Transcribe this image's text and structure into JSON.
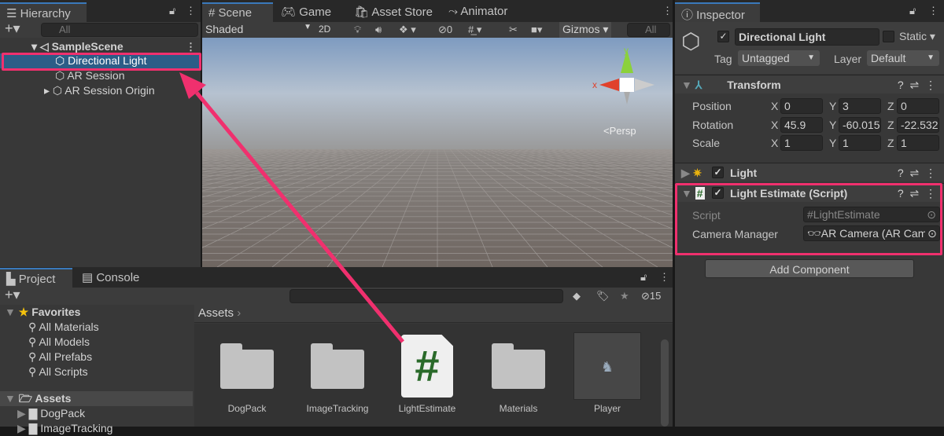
{
  "hierarchy": {
    "tab": "Hierarchy",
    "search_placeholder": "All",
    "scene": "SampleScene",
    "items": [
      "Directional Light",
      "AR Session",
      "AR Session Origin"
    ]
  },
  "scene": {
    "tabs": [
      "Scene",
      "Game",
      "Asset Store",
      "Animator"
    ],
    "shading": "Shaded",
    "mode_2d": "2D",
    "hidden_count": "0",
    "gizmos": "Gizmos",
    "search_placeholder": "All",
    "persp": "<Persp",
    "axis_y": "y",
    "axis_x": "x"
  },
  "inspector": {
    "tab": "Inspector",
    "object_name": "Directional Light",
    "static": "Static",
    "tag_label": "Tag",
    "tag": "Untagged",
    "layer_label": "Layer",
    "layer": "Default",
    "transform": {
      "title": "Transform",
      "rows": [
        {
          "label": "Position",
          "x": "0",
          "y": "3",
          "z": "0"
        },
        {
          "label": "Rotation",
          "x": "45.9",
          "y": "-60.015",
          "z": "-22.532"
        },
        {
          "label": "Scale",
          "x": "1",
          "y": "1",
          "z": "1"
        }
      ]
    },
    "light": {
      "title": "Light"
    },
    "light_estimate": {
      "title": "Light Estimate (Script)",
      "script_label": "Script",
      "script_value": "LightEstimate",
      "camera_label": "Camera Manager",
      "camera_value": "AR Camera (AR Camera Manager)"
    },
    "add_component": "Add Component"
  },
  "project": {
    "tabs": [
      "Project",
      "Console"
    ],
    "hidden_count": "15",
    "favorites": "Favorites",
    "fav_items": [
      "All Materials",
      "All Models",
      "All Prefabs",
      "All Scripts"
    ],
    "assets_root": "Assets",
    "tree": [
      "DogPack",
      "ImageTracking"
    ],
    "breadcrumb": "Assets",
    "assets": [
      "DogPack",
      "ImageTracking",
      "LightEstimate",
      "Materials",
      "Player"
    ]
  },
  "annotation_color": "#f0306e"
}
